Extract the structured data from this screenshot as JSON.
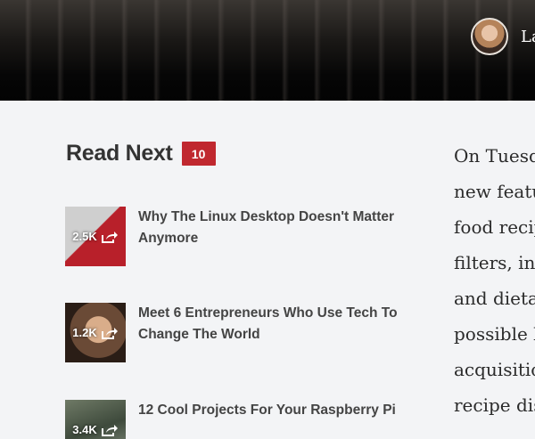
{
  "author": {
    "name": "La"
  },
  "read_next": {
    "title": "Read Next",
    "count": "10",
    "items": [
      {
        "share_count": "2.5K",
        "title": "Why The Linux Desktop Doesn't Matter Anymore"
      },
      {
        "share_count": "1.2K",
        "title": "Meet 6 Entrepreneurs Who Use Tech To Change The World"
      },
      {
        "share_count": "3.4K",
        "title": "12 Cool Projects For Your Raspberry Pi"
      }
    ]
  },
  "article": {
    "lines": [
      "On Tuesd",
      "new featu",
      "food recip",
      "filters, in",
      "and dieta",
      "possible b",
      "acquisitio",
      "recipe dis"
    ]
  },
  "colors": {
    "badge": "#c0282f",
    "heading": "#333333",
    "background": "#f3f4f6"
  }
}
